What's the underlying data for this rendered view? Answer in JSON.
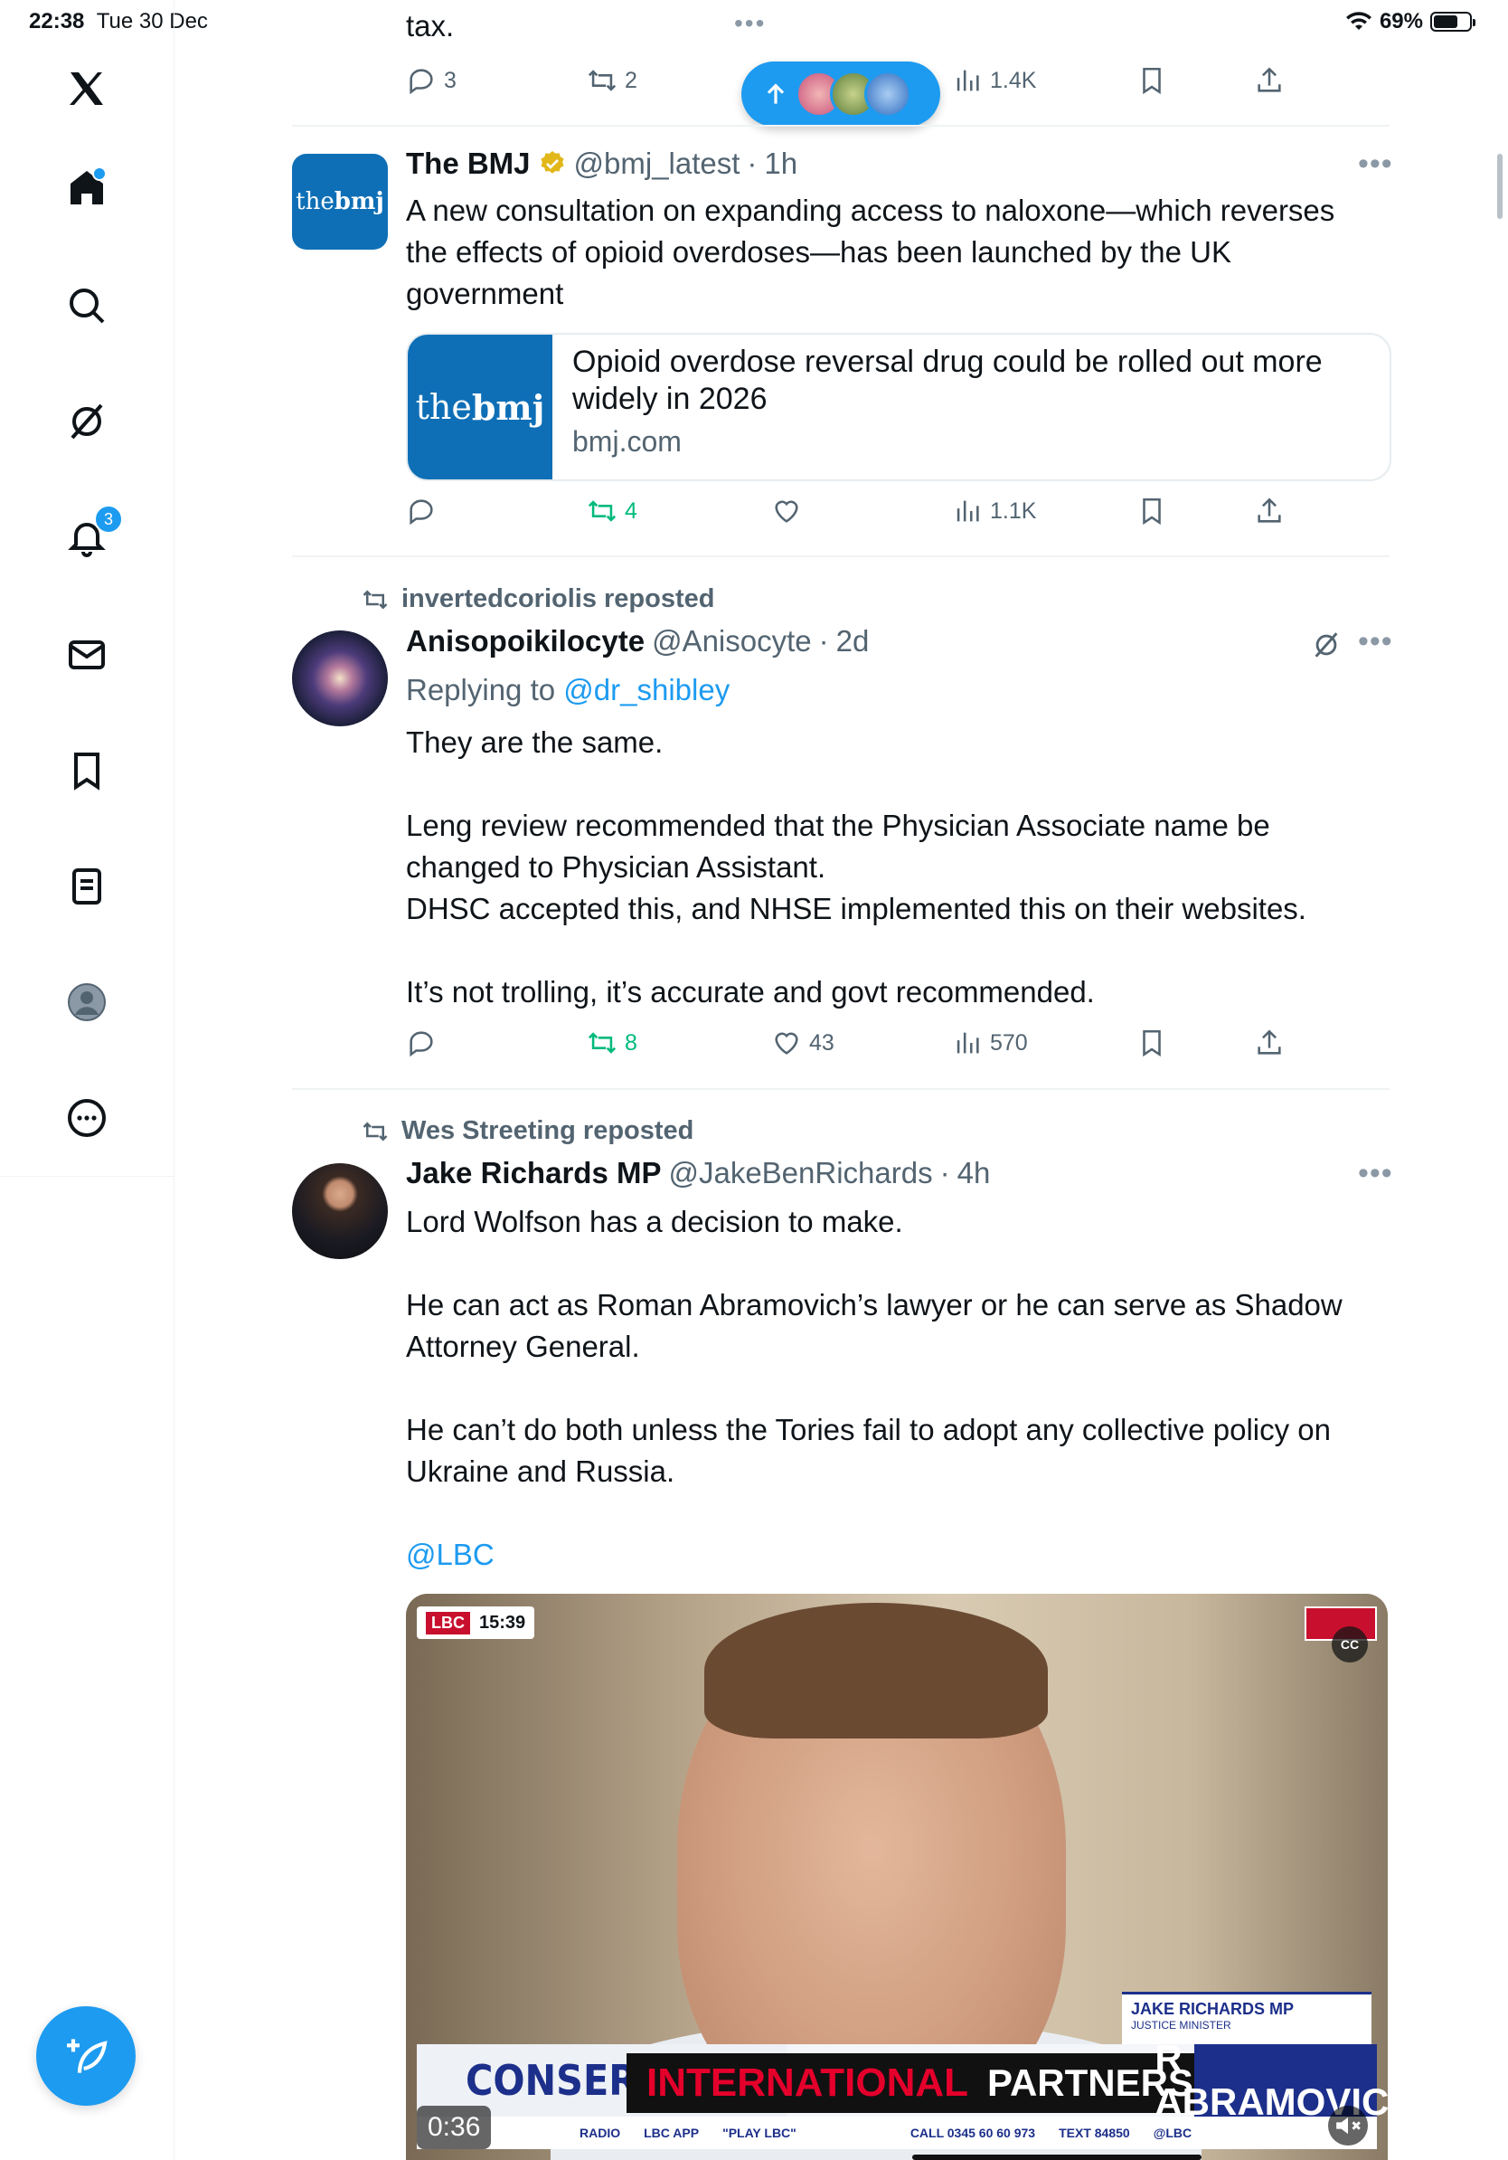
{
  "status_bar": {
    "time": "22:38",
    "date": "Tue 30 Dec",
    "battery": "69%",
    "battery_level": 0.69,
    "dots": "•••"
  },
  "sidebar": {
    "items": [
      "home",
      "search",
      "grok",
      "notifications",
      "messages",
      "bookmarks",
      "lists",
      "profile",
      "more"
    ],
    "notification_count": "3"
  },
  "prev_tweet": {
    "tail_text": "tax.",
    "replies": "3",
    "reposts": "2",
    "views": "1.4K"
  },
  "tweets": [
    {
      "name": "The BMJ",
      "handle": "@bmj_latest",
      "time": "1h",
      "text": "A new consultation on expanding access to naloxone—which reverses the effects of opioid overdoses—has been launched by the UK government",
      "card": {
        "logo_light": "the",
        "logo_bold": "bmj",
        "title": "Opioid overdose reversal drug could be rolled out more widely in 2026",
        "domain": "bmj.com"
      },
      "replies": "",
      "reposts": "4",
      "likes": "",
      "views": "1.1K"
    },
    {
      "reposted_by": "invertedcoriolis reposted",
      "name": "Anisopoikilocyte",
      "handle": "@Anisocyte",
      "time": "2d",
      "replying_prefix": "Replying to",
      "replying_to": "@dr_shibley",
      "text_1": "They are the same.",
      "text_2": "Leng review recommended that the Physician Associate name be changed to Physician Assistant.",
      "text_3": "DHSC accepted this, and NHSE implemented this on their websites.",
      "text_4": "It’s not trolling, it’s accurate and govt recommended.",
      "replies": "",
      "reposts": "8",
      "likes": "43",
      "views": "570"
    },
    {
      "reposted_by": "Wes Streeting reposted",
      "name": "Jake Richards MP",
      "handle": "@JakeBenRichards",
      "time": "4h",
      "text_1": "Lord Wolfson has a decision to make.",
      "text_2": "He can act as Roman Abramovich’s lawyer or he can serve as Shadow Attorney General.",
      "text_3": "He can’t do both unless the Tories fail to adopt any collective policy on Ukraine and Russia.",
      "mention": "@LBC",
      "video": {
        "lbc_logo": "LBC",
        "clock": "15:39",
        "cc": "CC",
        "nameplate_name": "JAKE RICHARDS MP",
        "nameplate_title": "JUSTICE MINISTER",
        "headline_left": "CONSERVAT",
        "headline_red": "INTERNATIONAL",
        "headline_partners": "PARTNERS",
        "headline_right": "R ABRAMOVICH",
        "ticker": [
          "RADIO",
          "LBC APP",
          "\"PLAY LBC\"",
          "CALL 0345 60 60 973",
          "TEXT 84850",
          "@LBC"
        ],
        "duration": "0:36"
      }
    }
  ],
  "colors": {
    "accent": "#1d9bf0",
    "repost_green": "#00ba7c",
    "muted": "#536471"
  }
}
